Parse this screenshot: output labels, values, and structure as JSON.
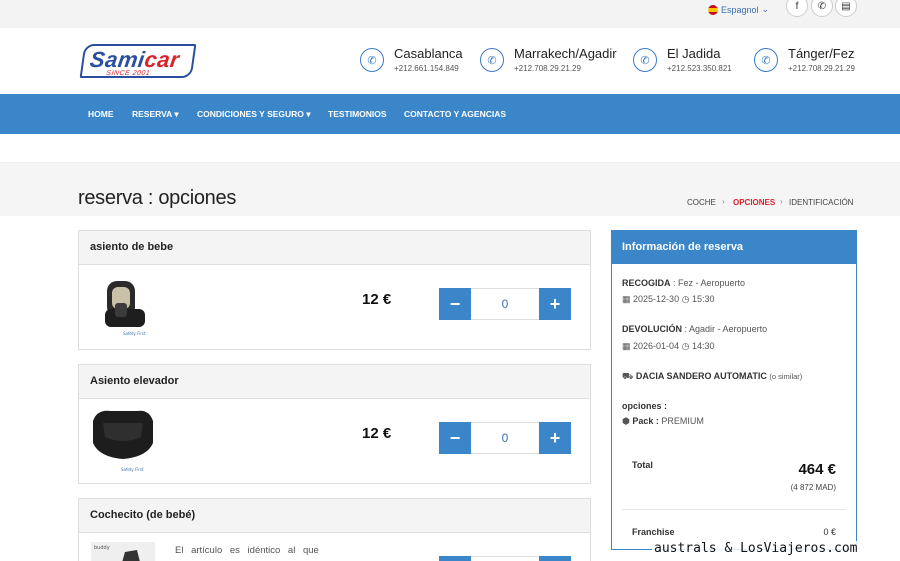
{
  "topbar": {
    "language": "Espagnol",
    "social": [
      {
        "icon": "facebook-icon",
        "glyph": "f"
      },
      {
        "icon": "whatsapp-icon",
        "glyph": "✆"
      },
      {
        "icon": "card-icon",
        "glyph": "▤"
      }
    ]
  },
  "logo": {
    "part1": "Sami",
    "part2": "car",
    "tagline": "SINCE 2001"
  },
  "contacts": [
    {
      "city": "Casablanca",
      "phone": "+212.661.154.849"
    },
    {
      "city": "Marrakech/Agadir",
      "phone": "+212.708.29.21.29"
    },
    {
      "city": "El Jadida",
      "phone": "+212.523.350.821"
    },
    {
      "city": "Tánger/Fez",
      "phone": "+212.708.29.21.29"
    }
  ],
  "nav": [
    {
      "label": "HOME"
    },
    {
      "label": "RESERVA ▾"
    },
    {
      "label": "CONDICIONES Y SEGURO ▾"
    },
    {
      "label": "TESTIMONIOS"
    },
    {
      "label": "CONTACTO Y AGENCIAS"
    }
  ],
  "page": {
    "title": "reserva : opciones"
  },
  "breadcrumb": [
    {
      "label": "COCHE",
      "active": false
    },
    {
      "label": "OPCIONES",
      "active": true
    },
    {
      "label": "IDENTIFICACIÓN",
      "active": false
    }
  ],
  "options": [
    {
      "name": "asiento de bebe",
      "price": "12 €",
      "quantity": "0",
      "minus": "−",
      "plus": "+"
    },
    {
      "name": "Asiento elevador",
      "price": "12 €",
      "quantity": "0",
      "minus": "−",
      "plus": "+"
    },
    {
      "name": "Cochecito (de bebé)",
      "description": "El artículo es idéntico al que",
      "minus": "−",
      "plus": "+"
    }
  ],
  "summary": {
    "title": "Información de reserva",
    "pickup_label": "RECOGIDA",
    "pickup_place": ": Fez - Aeropuerto",
    "pickup_date": "2025-12-30",
    "pickup_time": "15:30",
    "return_label": "DEVOLUCIÓN",
    "return_place": ": Agadir - Aeropuerto",
    "return_date": "2026-01-04",
    "return_time": "14:30",
    "car": "DACIA SANDERO AUTOMATIC",
    "car_note": "(o similar)",
    "options_label": "opciones :",
    "pack_label": "Pack :",
    "pack_value": "PREMIUM",
    "total_label": "Total",
    "total_value": "464 €",
    "total_mad": "(4 872 MAD)",
    "franchise_label": "Franchise",
    "franchise_value": "0 €"
  },
  "watermark": "australs & LosViajeros.com",
  "colors": {
    "primary": "#3a86c8",
    "brand_blue": "#2b4fa0",
    "brand_red": "#d8232a"
  }
}
